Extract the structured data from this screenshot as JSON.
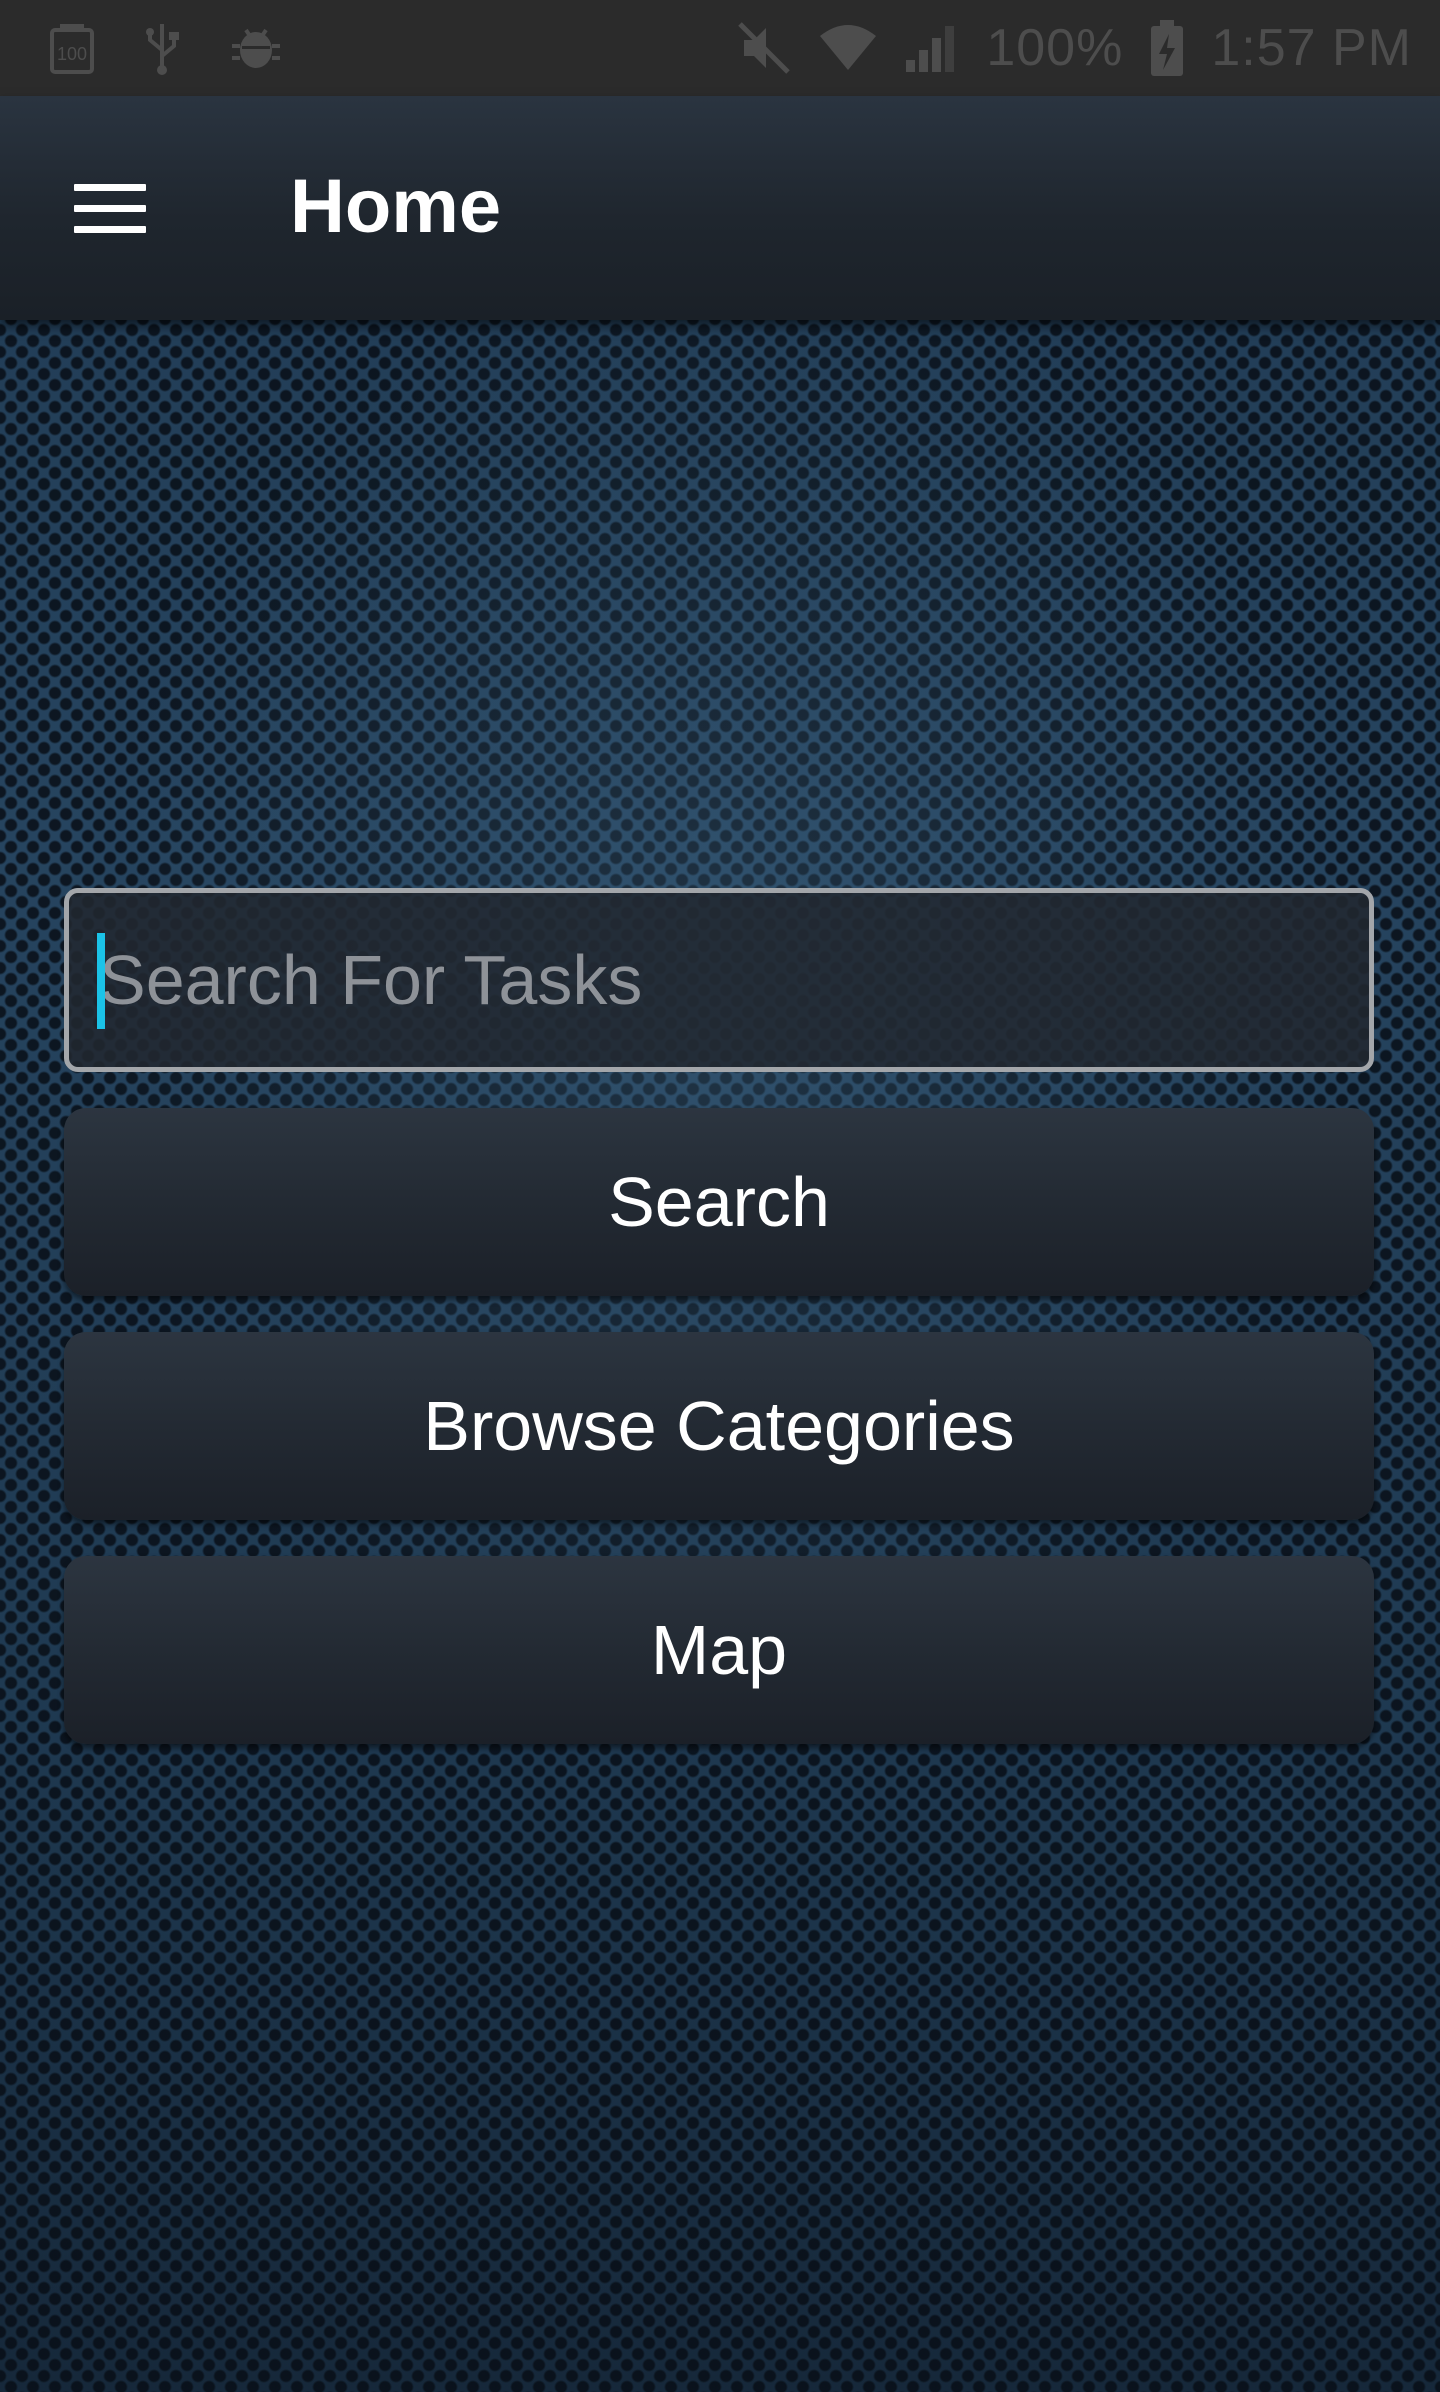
{
  "status_bar": {
    "icons_left": [
      "badge-100-icon",
      "usb-icon",
      "android-debug-icon"
    ],
    "icons_right": [
      "mute-icon",
      "wifi-icon",
      "signal-icon"
    ],
    "battery_percent": "100%",
    "battery_icon": "battery-charging-icon",
    "time": "1:57 PM"
  },
  "app_bar": {
    "menu_icon": "hamburger-menu-icon",
    "title": "Home"
  },
  "search": {
    "placeholder": "Search For Tasks",
    "value": ""
  },
  "buttons": {
    "search": "Search",
    "browse": "Browse Categories",
    "map": "Map"
  },
  "colors": {
    "cursor": "#1bc3e8",
    "background": "#24405a",
    "app_bar": "#1f262e"
  }
}
